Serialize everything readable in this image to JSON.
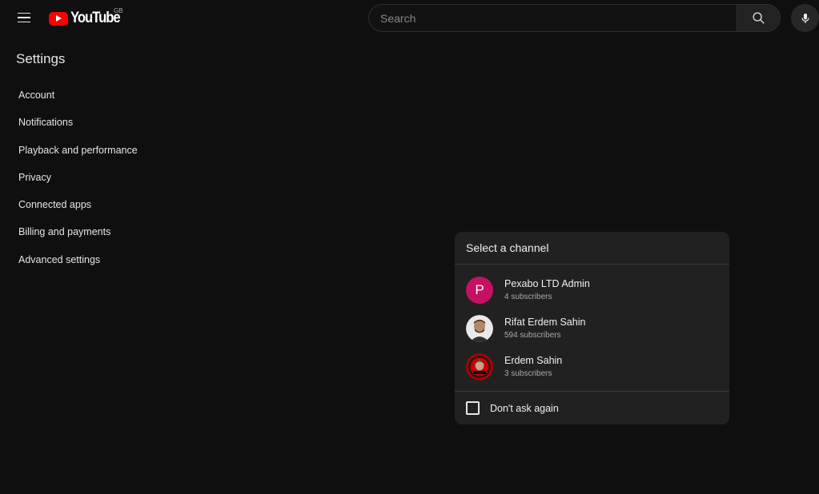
{
  "header": {
    "logo_text": "YouTube",
    "country_code": "GB",
    "search_placeholder": "Search"
  },
  "settings": {
    "title": "Settings",
    "nav_items": [
      "Account",
      "Notifications",
      "Playback and performance",
      "Privacy",
      "Connected apps",
      "Billing and payments",
      "Advanced settings"
    ]
  },
  "dialog": {
    "title": "Select a channel",
    "channels": [
      {
        "name": "Pexabo LTD Admin",
        "subscribers": "4 subscribers",
        "avatar_letter": "P",
        "avatar_color": "#c51162"
      },
      {
        "name": "Rifat Erdem Sahin",
        "subscribers": "594 subscribers"
      },
      {
        "name": "Erdem Sahin",
        "subscribers": "3 subscribers"
      }
    ],
    "dont_ask_label": "Don't ask again"
  },
  "colors": {
    "background": "#0f0f0f",
    "dialog_bg": "#212121",
    "brand_red": "#ff0000"
  }
}
